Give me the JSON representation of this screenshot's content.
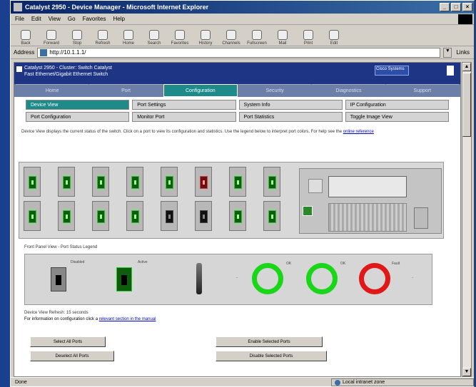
{
  "window": {
    "title": "Catalyst 2950 - Device Manager - Microsoft Internet Explorer",
    "minimize": "_",
    "maximize": "□",
    "close": "×"
  },
  "menu": [
    "File",
    "Edit",
    "View",
    "Go",
    "Favorites",
    "Help"
  ],
  "toolbar": [
    "Back",
    "Forward",
    "Stop",
    "Refresh",
    "Home",
    "Search",
    "Favorites",
    "History",
    "Channels",
    "Fullscreen",
    "Mail",
    "Print",
    "Edit"
  ],
  "address": {
    "label": "Address",
    "value": "http://10.1.1.1/",
    "go": "Links"
  },
  "header": {
    "line1": "Catalyst 2950 - Cluster: Switch Catalyst",
    "line2": "Fast Ethernet/Gigabit Ethernet Switch",
    "brand": "Cisco Systems"
  },
  "main_tabs": [
    {
      "label": "Home",
      "active": false
    },
    {
      "label": "Port",
      "active": false
    },
    {
      "label": "Configuration",
      "active": true
    },
    {
      "label": "Security",
      "active": false
    },
    {
      "label": "Diagnostics",
      "active": false
    },
    {
      "label": "Support",
      "active": false
    }
  ],
  "sub_tabs": [
    {
      "label": "Device View",
      "active": true
    },
    {
      "label": "Port Settings",
      "active": false
    },
    {
      "label": "System Info",
      "active": false
    },
    {
      "label": "IP Configuration",
      "active": false
    },
    {
      "label": "Port Configuration",
      "active": false
    },
    {
      "label": "Monitor Port",
      "active": false
    },
    {
      "label": "Port Statistics",
      "active": false
    },
    {
      "label": "Toggle Image View",
      "active": false
    }
  ],
  "intro": {
    "text": "Device View displays the current status of the switch. Click on a port to view its configuration and statistics. Use the legend below to interpret port colors. For help see the",
    "link": "online reference"
  },
  "chassis": {
    "top_row": [
      "ok",
      "ok",
      "ok",
      "ok",
      "ok",
      "err",
      "ok",
      "ok"
    ],
    "bottom_row": [
      "ok",
      "ok",
      "ok",
      "ok",
      "idle",
      "idle",
      "ok",
      "ok"
    ]
  },
  "caption": "Front Panel View - Port Status Legend",
  "legend": {
    "port_disabled_label": "Disabled",
    "port_active_label": "Active",
    "ring_labels": [
      "OK",
      "OK",
      "Fault"
    ]
  },
  "footer": {
    "line1": "Device View Refresh: 15 seconds",
    "line2_prefix": "For information on configuration click a",
    "line2_link": "relevant section in the manual"
  },
  "buttons": {
    "select_all": "Select All Ports",
    "deselect_all": "Deselect All Ports",
    "enable_selected": "Enable Selected Ports",
    "disable_selected": "Disable Selected Ports"
  },
  "status": {
    "left": "Done",
    "zone": "Local intranet zone"
  }
}
